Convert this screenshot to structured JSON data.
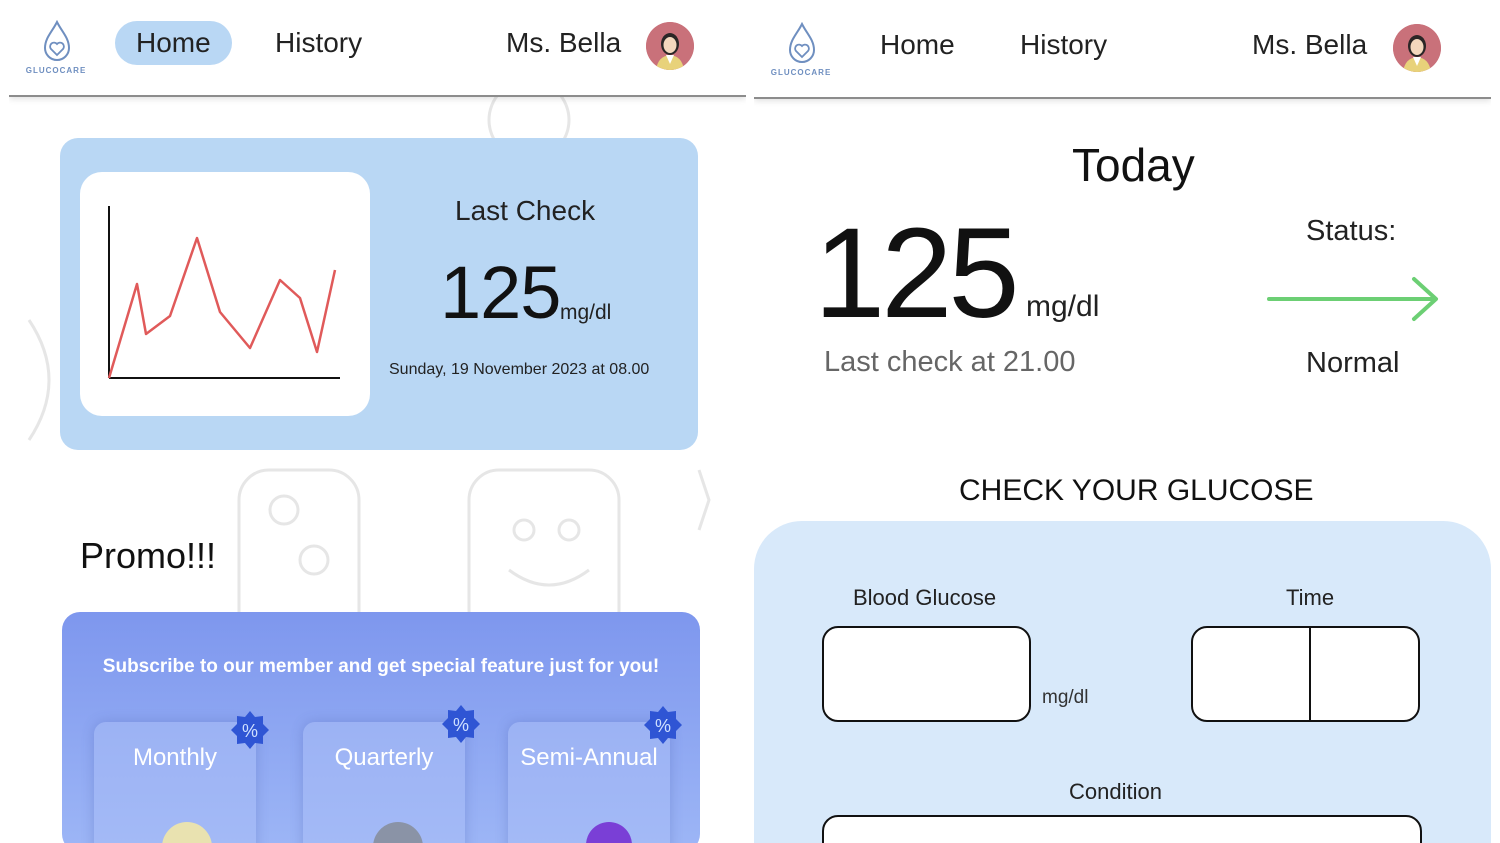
{
  "left_screen": {
    "nav": {
      "logo_text": "GLUCOCARE",
      "home_label": "Home",
      "history_label": "History",
      "user_name": "Ms. Bella"
    },
    "last_check": {
      "title": "Last Check",
      "value": "125",
      "unit": "mg/dl",
      "datetime": "Sunday, 19 November 2023 at 08.00",
      "trend_color": "#e05a5a"
    },
    "promo": {
      "title": "Promo!!!",
      "message": "Subscribe to our member and get special feature just for you!",
      "plans": [
        {
          "label": "Monthly"
        },
        {
          "label": "Quarterly"
        },
        {
          "label": "Semi-Annual"
        }
      ],
      "badge_icon": "discount-percent-icon",
      "badge_color": "#2f55d4"
    }
  },
  "right_screen": {
    "nav": {
      "logo_text": "GLUCOCARE",
      "home_label": "Home",
      "history_label": "History",
      "user_name": "Ms. Bella"
    },
    "today": {
      "title": "Today",
      "value": "125",
      "unit": "mg/dl",
      "last_check_text": "Last check at 21.00",
      "status_label": "Status:",
      "status_value": "Normal",
      "status_color": "#6ccf74"
    },
    "check_form": {
      "title": "CHECK YOUR GLUCOSE",
      "blood_glucose_label": "Blood Glucose",
      "blood_glucose_value": "",
      "blood_glucose_unit": "mg/dl",
      "time_label": "Time",
      "time_hour_value": "",
      "time_minute_value": "",
      "condition_label": "Condition",
      "condition_value": ""
    }
  },
  "colors": {
    "accent_light_blue": "#b9d7f4",
    "form_bg": "#d8e9fa",
    "promo_gradient_top": "#7e97ee"
  }
}
